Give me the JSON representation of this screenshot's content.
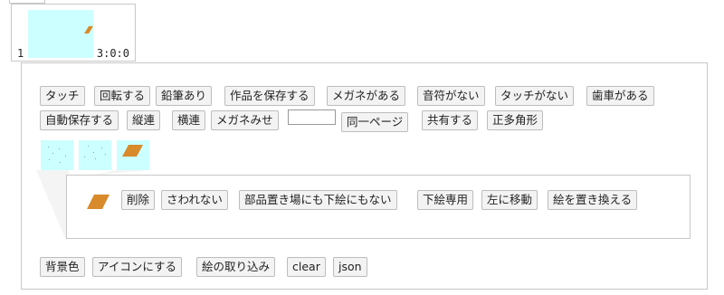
{
  "thumbnail": {
    "left_label": "1",
    "right_label": "3:0:0"
  },
  "toolbar_row1": [
    "タッチ",
    "回転する",
    "鉛筆あり",
    "作品を保存する",
    "メガネがある",
    "音符がない",
    "タッチがない",
    "歯車がある"
  ],
  "toolbar_row2": [
    "自動保存する",
    "縦連",
    "横連",
    "メガネみせ"
  ],
  "toolbar_row2b": [
    "同一ページ",
    "共有する",
    "正多角形"
  ],
  "part_actions": [
    "削除",
    "さわれない",
    "部品置き場にも下絵にもない",
    "下絵専用",
    "左に移動",
    "絵を置き換える"
  ],
  "bottom_buttons": [
    "背景色",
    "アイコンにする",
    "絵の取り込み",
    "clear",
    "json"
  ],
  "colors": {
    "canvas_bg": "#ccffff",
    "shape": "#d98a2a",
    "border": "#c8c8c8"
  },
  "icons": {
    "shape": "parallelogram-icon"
  }
}
